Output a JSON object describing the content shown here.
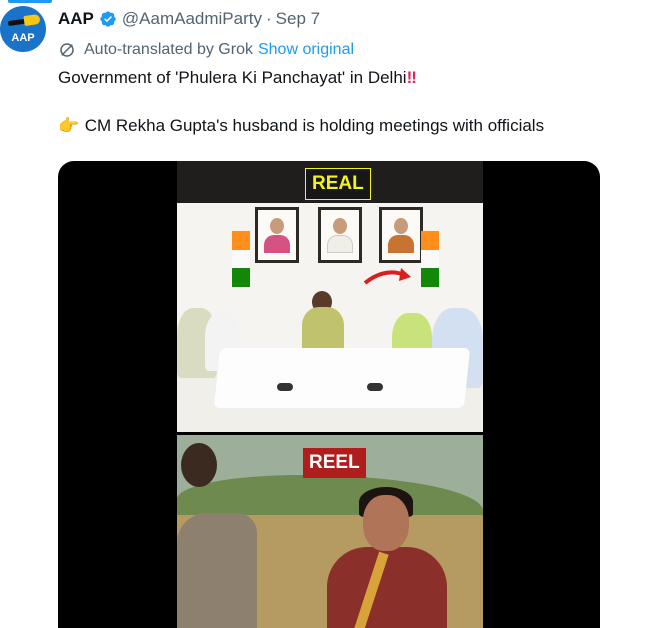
{
  "account": {
    "avatar_text": "AAP",
    "display_name": "AAP",
    "handle": "@AamAadmiParty",
    "separator": "·",
    "date": "Sep 7"
  },
  "translation": {
    "notice": "Auto-translated by Grok",
    "show_original": "Show original"
  },
  "tweet": {
    "line1": "Government of 'Phulera Ki Panchayat' in Delhi",
    "line1_emoji": "‼",
    "line2_emoji": "👉",
    "line2": "CM Rekha Gupta's husband is holding meetings with officials"
  },
  "media": {
    "label_top": "REAL",
    "label_bottom": "REEL"
  },
  "colors": {
    "accent": "#1d9bf0",
    "secondary_text": "#536471",
    "real_label_text": "#f4f11d",
    "reel_label_bg": "#b01d1d"
  },
  "icons": {
    "verified": "verified-badge-icon",
    "translate": "translate-icon",
    "pointing_hand": "pointing-right-hand-emoji"
  }
}
